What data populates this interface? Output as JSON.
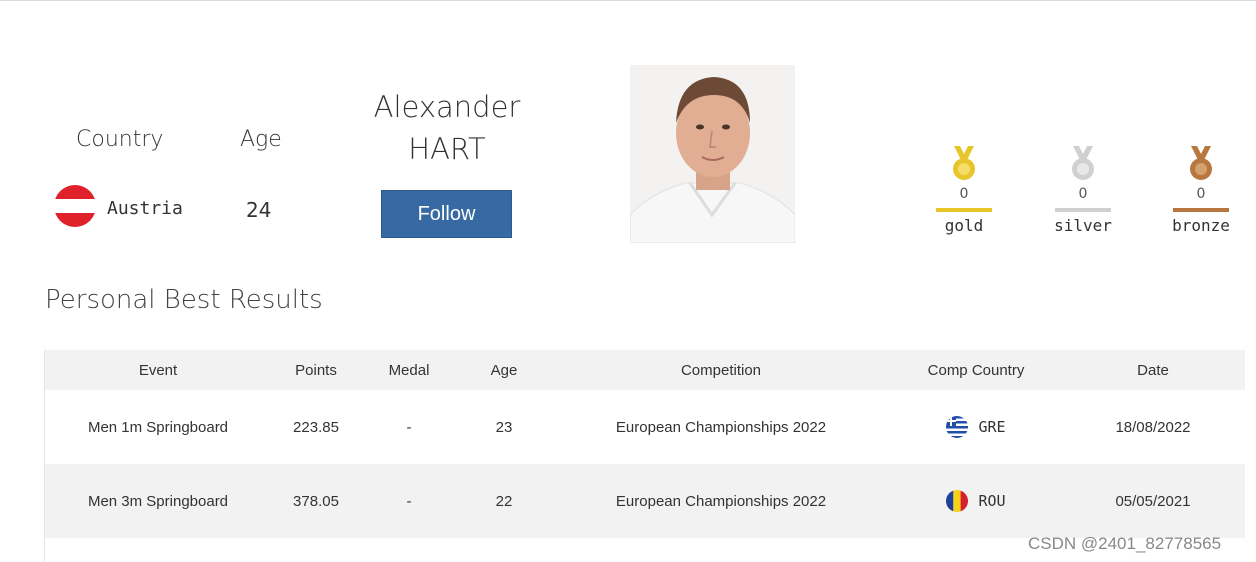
{
  "profile": {
    "country_label": "Country",
    "age_label": "Age",
    "country": "Austria",
    "age": "24",
    "first_name": "Alexander",
    "last_name": "HART",
    "follow_label": "Follow"
  },
  "medals": [
    {
      "name": "gold",
      "count": "0",
      "color": "#e8c52b"
    },
    {
      "name": "silver",
      "count": "0",
      "color": "#d0d0d0"
    },
    {
      "name": "bronze",
      "count": "0",
      "color": "#b8773e"
    }
  ],
  "section_title": "Personal Best Results",
  "table": {
    "headers": [
      "Event",
      "Points",
      "Medal",
      "Age",
      "Competition",
      "Comp Country",
      "Date"
    ],
    "rows": [
      {
        "event": "Men 1m Springboard",
        "points": "223.85",
        "medal": "-",
        "age": "23",
        "competition": "European Championships 2022",
        "country_code": "GRE",
        "date": "18/08/2022"
      },
      {
        "event": "Men 3m Springboard",
        "points": "378.05",
        "medal": "-",
        "age": "22",
        "competition": "European Championships 2022",
        "country_code": "ROU",
        "date": "05/05/2021"
      }
    ]
  },
  "watermark": "CSDN @2401_82778565"
}
